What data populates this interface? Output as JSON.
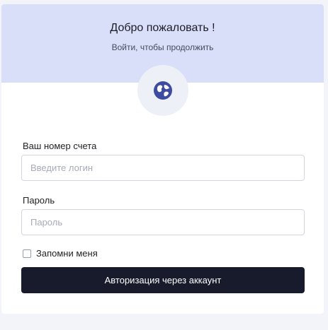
{
  "header": {
    "title": "Добро пожаловать !",
    "subtitle": "Войти, чтобы продолжить",
    "logo_icon": "globe-icon"
  },
  "form": {
    "account_label": "Ваш номер счета",
    "account_placeholder": "Введите логин",
    "account_value": "",
    "password_label": "Пароль",
    "password_placeholder": "Пароль",
    "password_value": "",
    "remember_label": "Запомни меня",
    "remember_checked": false,
    "submit_label": "Авторизация через аккаунт"
  },
  "colors": {
    "header_bg": "#dadff9",
    "button_bg": "#171b2c",
    "icon_color": "#3d4ba0"
  }
}
